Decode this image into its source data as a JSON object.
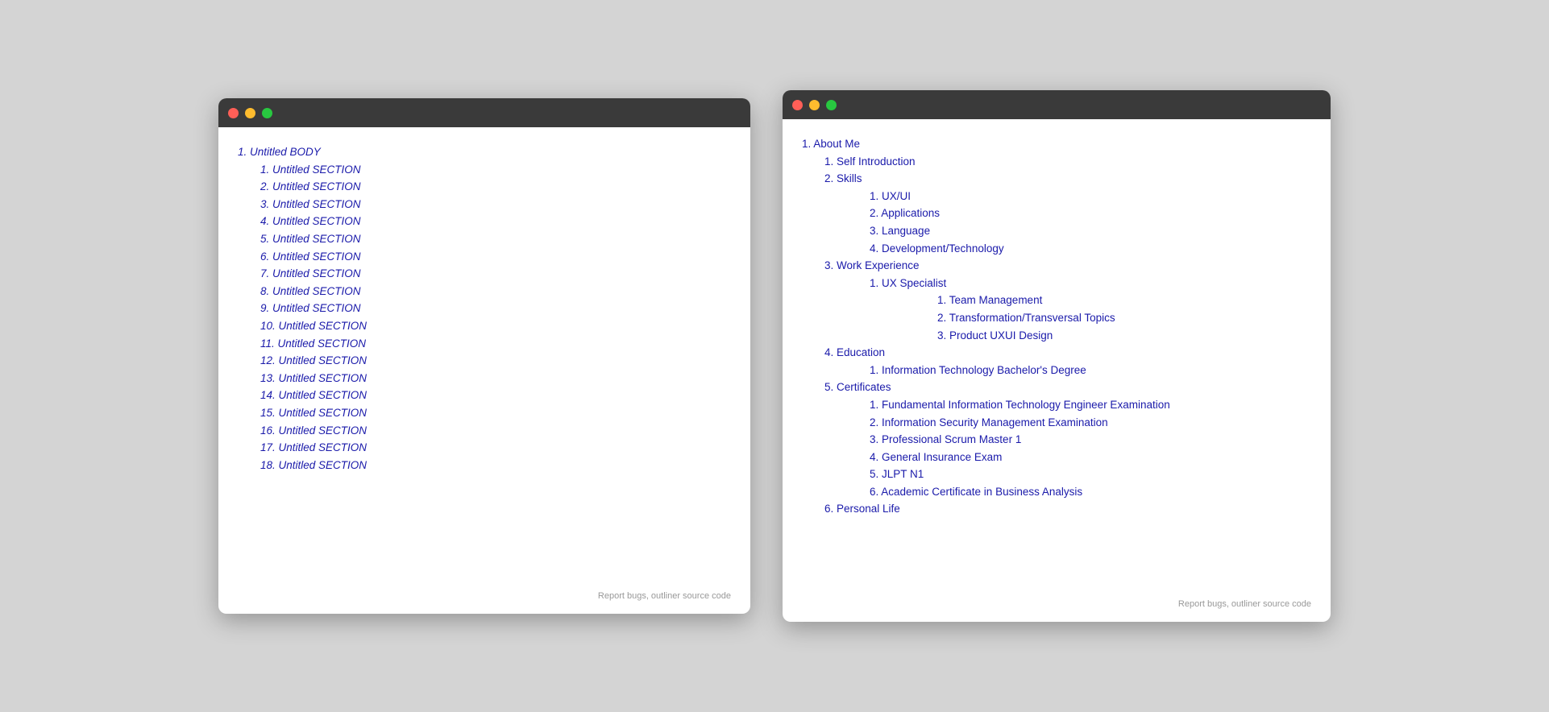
{
  "left_window": {
    "title": "",
    "root_item": "1. Untitled BODY",
    "sections": [
      {
        "num": 1,
        "label": "Untitled SECTION"
      },
      {
        "num": 2,
        "label": "Untitled SECTION"
      },
      {
        "num": 3,
        "label": "Untitled SECTION"
      },
      {
        "num": 4,
        "label": "Untitled SECTION"
      },
      {
        "num": 5,
        "label": "Untitled SECTION"
      },
      {
        "num": 6,
        "label": "Untitled SECTION"
      },
      {
        "num": 7,
        "label": "Untitled SECTION"
      },
      {
        "num": 8,
        "label": "Untitled SECTION"
      },
      {
        "num": 9,
        "label": "Untitled SECTION"
      },
      {
        "num": 10,
        "label": "Untitled SECTION"
      },
      {
        "num": 11,
        "label": "Untitled SECTION"
      },
      {
        "num": 12,
        "label": "Untitled SECTION"
      },
      {
        "num": 13,
        "label": "Untitled SECTION"
      },
      {
        "num": 14,
        "label": "Untitled SECTION"
      },
      {
        "num": 15,
        "label": "Untitled SECTION"
      },
      {
        "num": 16,
        "label": "Untitled SECTION"
      },
      {
        "num": 17,
        "label": "Untitled SECTION"
      },
      {
        "num": 18,
        "label": "Untitled SECTION"
      }
    ],
    "footer": "Report bugs, outliner source code"
  },
  "right_window": {
    "title": "",
    "tree": [
      {
        "num": 1,
        "label": "About Me",
        "children": [
          {
            "num": 1,
            "label": "Self Introduction",
            "children": []
          },
          {
            "num": 2,
            "label": "Skills",
            "children": [
              {
                "num": 1,
                "label": "UX/UI",
                "children": []
              },
              {
                "num": 2,
                "label": "Applications",
                "children": []
              },
              {
                "num": 3,
                "label": "Language",
                "children": []
              },
              {
                "num": 4,
                "label": "Development/Technology",
                "children": []
              }
            ]
          },
          {
            "num": 3,
            "label": "Work Experience",
            "children": [
              {
                "num": 1,
                "label": "UX Specialist",
                "children": [
                  {
                    "num": 1,
                    "label": "Team Management",
                    "children": []
                  },
                  {
                    "num": 2,
                    "label": "Transformation/Transversal Topics",
                    "children": []
                  },
                  {
                    "num": 3,
                    "label": "Product UXUI Design",
                    "children": []
                  }
                ]
              }
            ]
          },
          {
            "num": 4,
            "label": "Education",
            "children": [
              {
                "num": 1,
                "label": "Information Technology Bachelor's Degree",
                "children": []
              }
            ]
          },
          {
            "num": 5,
            "label": "Certificates",
            "children": [
              {
                "num": 1,
                "label": "Fundamental Information Technology Engineer Examination",
                "children": []
              },
              {
                "num": 2,
                "label": "Information Security Management Examination",
                "children": []
              },
              {
                "num": 3,
                "label": "Professional Scrum Master 1",
                "children": []
              },
              {
                "num": 4,
                "label": "General Insurance Exam",
                "children": []
              },
              {
                "num": 5,
                "label": "JLPT N1",
                "children": []
              },
              {
                "num": 6,
                "label": "Academic Certificate in Business Analysis",
                "children": []
              }
            ]
          },
          {
            "num": 6,
            "label": "Personal Life",
            "children": []
          }
        ]
      }
    ],
    "footer": "Report bugs, outliner source code"
  }
}
